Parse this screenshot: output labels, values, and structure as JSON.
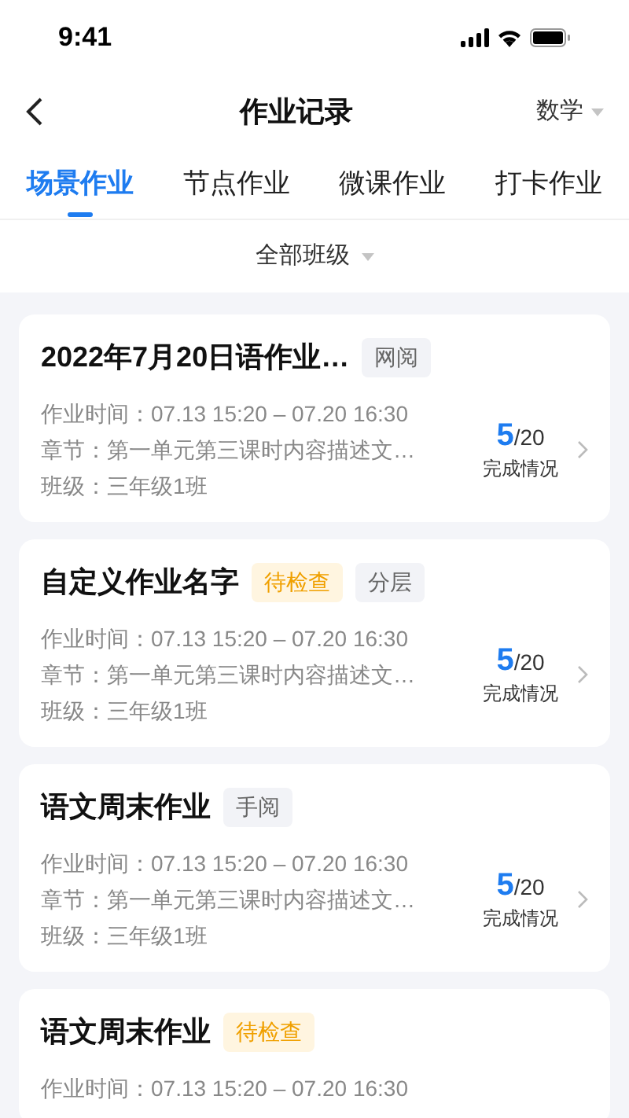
{
  "status_bar": {
    "time": "9:41"
  },
  "nav": {
    "title": "作业记录",
    "subject": "数学"
  },
  "tabs": [
    {
      "label": "场景作业",
      "selected": true
    },
    {
      "label": "节点作业",
      "selected": false
    },
    {
      "label": "微课作业",
      "selected": false
    },
    {
      "label": "打卡作业",
      "selected": false
    }
  ],
  "filter": {
    "label": "全部班级"
  },
  "cards": [
    {
      "title": "2022年7月20日语作业…",
      "tags": [
        {
          "label": "网阅",
          "kind": "plain"
        }
      ],
      "lines": [
        "作业时间：07.13 15:20 – 07.20 16:30",
        "章节：第一单元第三课时内容描述文…",
        "班级：三年级1班"
      ],
      "done": "5",
      "total": "/20",
      "status_label": "完成情况"
    },
    {
      "title": "自定义作业名字",
      "tags": [
        {
          "label": "待检查",
          "kind": "pending"
        },
        {
          "label": "分层",
          "kind": "plain"
        }
      ],
      "lines": [
        "作业时间：07.13 15:20 – 07.20 16:30",
        "章节：第一单元第三课时内容描述文…",
        "班级：三年级1班"
      ],
      "done": "5",
      "total": "/20",
      "status_label": "完成情况"
    },
    {
      "title": "语文周末作业",
      "tags": [
        {
          "label": "手阅",
          "kind": "plain"
        }
      ],
      "lines": [
        "作业时间：07.13 15:20 – 07.20 16:30",
        "章节：第一单元第三课时内容描述文…",
        "班级：三年级1班"
      ],
      "done": "5",
      "total": "/20",
      "status_label": "完成情况"
    },
    {
      "title": "语文周末作业",
      "tags": [
        {
          "label": "待检查",
          "kind": "pending"
        }
      ],
      "lines": [
        "作业时间：07.13 15:20 – 07.20 16:30"
      ]
    }
  ]
}
